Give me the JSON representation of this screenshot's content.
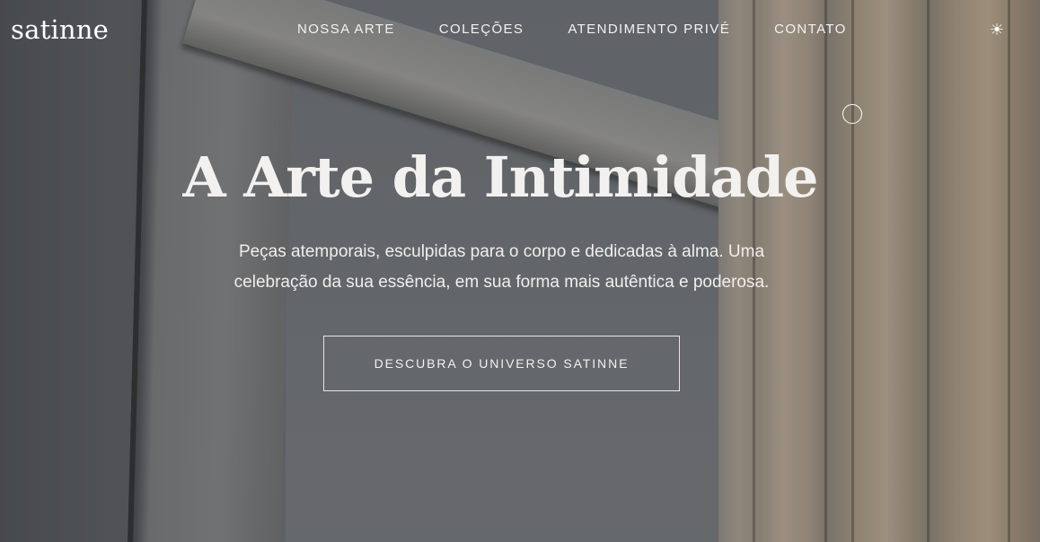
{
  "brand": {
    "logo_text": "satinne"
  },
  "nav": {
    "items": [
      {
        "label": "NOSSA ARTE"
      },
      {
        "label": "COLEÇÕES"
      },
      {
        "label": "ATENDIMENTO PRIVÉ"
      },
      {
        "label": "CONTATO"
      }
    ],
    "theme_toggle_icon": "☀"
  },
  "hero": {
    "headline": "A Arte da Intimidade",
    "subtitle": "Peças atemporais, esculpidas para o corpo e dedicadas à alma. Uma celebração da sua essência, em sua forma mais autêntica e poderosa.",
    "cta_label": "DESCUBRA O UNIVERSO SATINNE"
  },
  "icons": {
    "theme_toggle": "sun-icon",
    "cursor": "cursor-ring-icon"
  },
  "colors": {
    "text": "#f3f1ef",
    "cta_border": "#e9e6e2"
  }
}
